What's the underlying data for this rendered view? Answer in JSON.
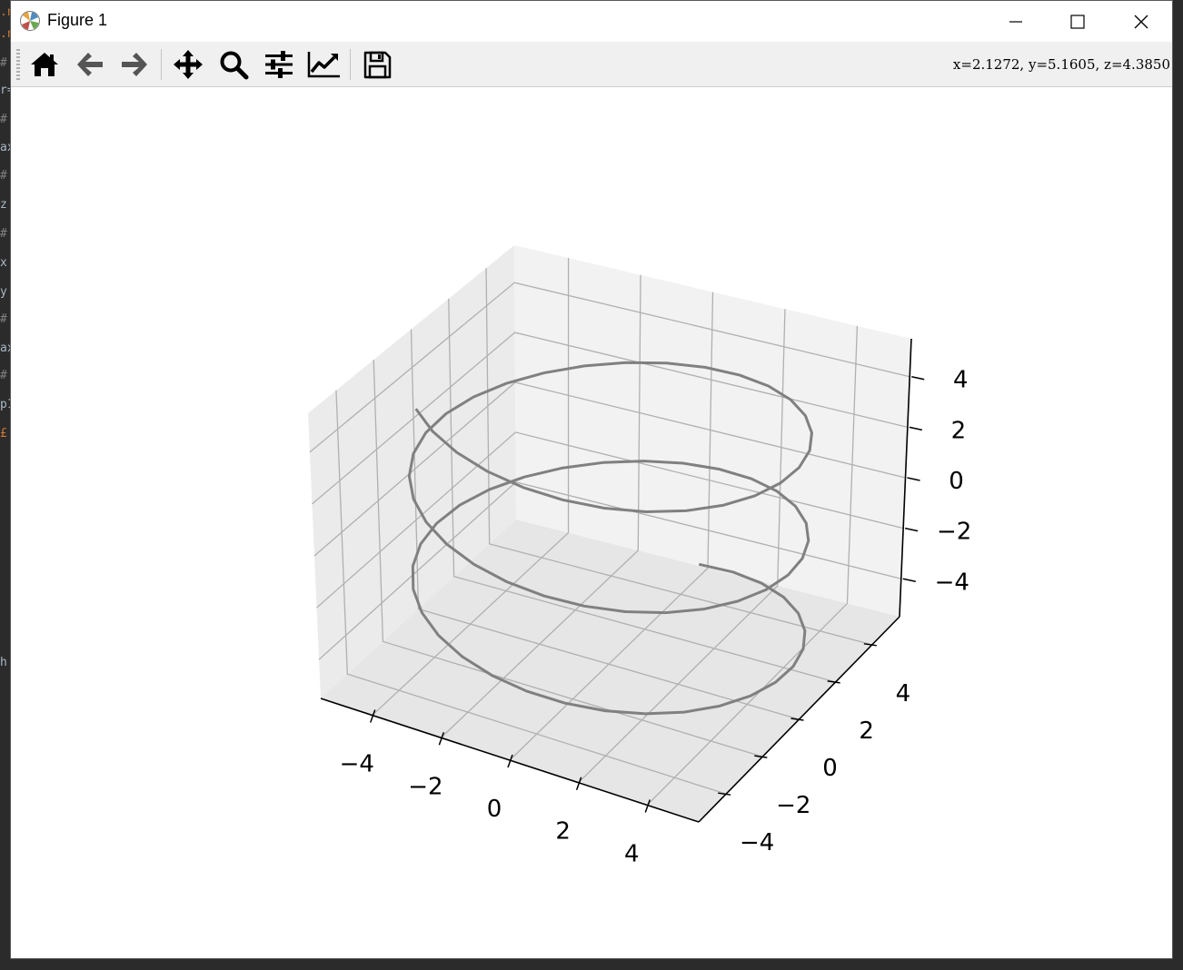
{
  "window": {
    "title": "Figure 1"
  },
  "toolbar": {
    "buttons": [
      {
        "name": "home",
        "icon": "home-icon"
      },
      {
        "name": "back",
        "icon": "arrow-left-icon"
      },
      {
        "name": "forward",
        "icon": "arrow-right-icon"
      },
      {
        "name": "pan",
        "icon": "move-icon"
      },
      {
        "name": "zoom",
        "icon": "magnifier-icon"
      },
      {
        "name": "configure-subplots",
        "icon": "sliders-icon"
      },
      {
        "name": "edit-axis",
        "icon": "line-chart-icon"
      },
      {
        "name": "save",
        "icon": "floppy-disk-icon"
      }
    ],
    "coordinates": "x=2.1272,  y=5.1605,  z=4.3850"
  },
  "chart_data": {
    "type": "line",
    "projection": "3d",
    "title": "",
    "xlabel": "",
    "ylabel": "",
    "zlabel": "",
    "xticks": [
      "−4",
      "−2",
      "0",
      "2",
      "4"
    ],
    "yticks": [
      "−4",
      "−2",
      "0",
      "2",
      "4"
    ],
    "zticks": [
      "−4",
      "−2",
      "0",
      "2",
      "4"
    ],
    "xlim": [
      -5.5,
      5.5
    ],
    "ylim": [
      -5.5,
      5.5
    ],
    "zlim": [
      -5.5,
      5.5
    ],
    "grid": true,
    "series": [
      {
        "color": "#808080",
        "parametric": {
          "x": "5·sin(t)",
          "y": "5·cos(t)",
          "z": "t/1.6 − 5"
        },
        "t_range": [
          0,
          16.5
        ],
        "description_points": 80
      }
    ],
    "pane_color": "#f2f2f2",
    "grid_color": "#b0b0b0"
  }
}
